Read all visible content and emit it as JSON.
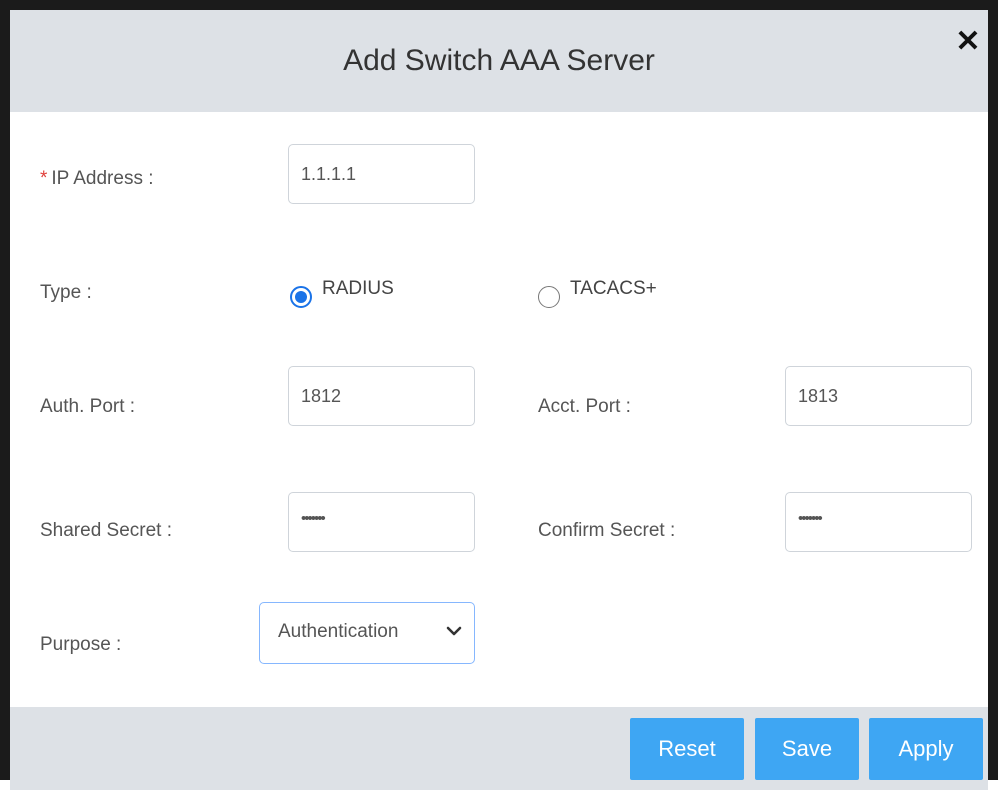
{
  "dialog": {
    "title": "Add Switch AAA Server",
    "close_icon": "close-icon"
  },
  "form": {
    "ip_address": {
      "required_mark": "*",
      "label": "IP Address :",
      "value": "1.1.1.1"
    },
    "type": {
      "label": "Type :",
      "options": [
        {
          "label": "RADIUS",
          "selected": true
        },
        {
          "label": "TACACS+",
          "selected": false
        }
      ]
    },
    "auth_port": {
      "label": "Auth. Port :",
      "value": "1812"
    },
    "acct_port": {
      "label": "Acct. Port :",
      "value": "1813"
    },
    "shared_secret": {
      "label": "Shared Secret :",
      "value": "•••••••"
    },
    "confirm_secret": {
      "label": "Confirm Secret :",
      "value": "•••••••"
    },
    "purpose": {
      "label": "Purpose :",
      "selected": "Authentication",
      "icon": "chevron-down-icon"
    }
  },
  "footer": {
    "reset_label": "Reset",
    "save_label": "Save",
    "apply_label": "Apply"
  },
  "colors": {
    "header_bg": "#dde1e6",
    "button_bg": "#3ea6f3",
    "radio_accent": "#1a73e8",
    "required": "#e0403b"
  }
}
